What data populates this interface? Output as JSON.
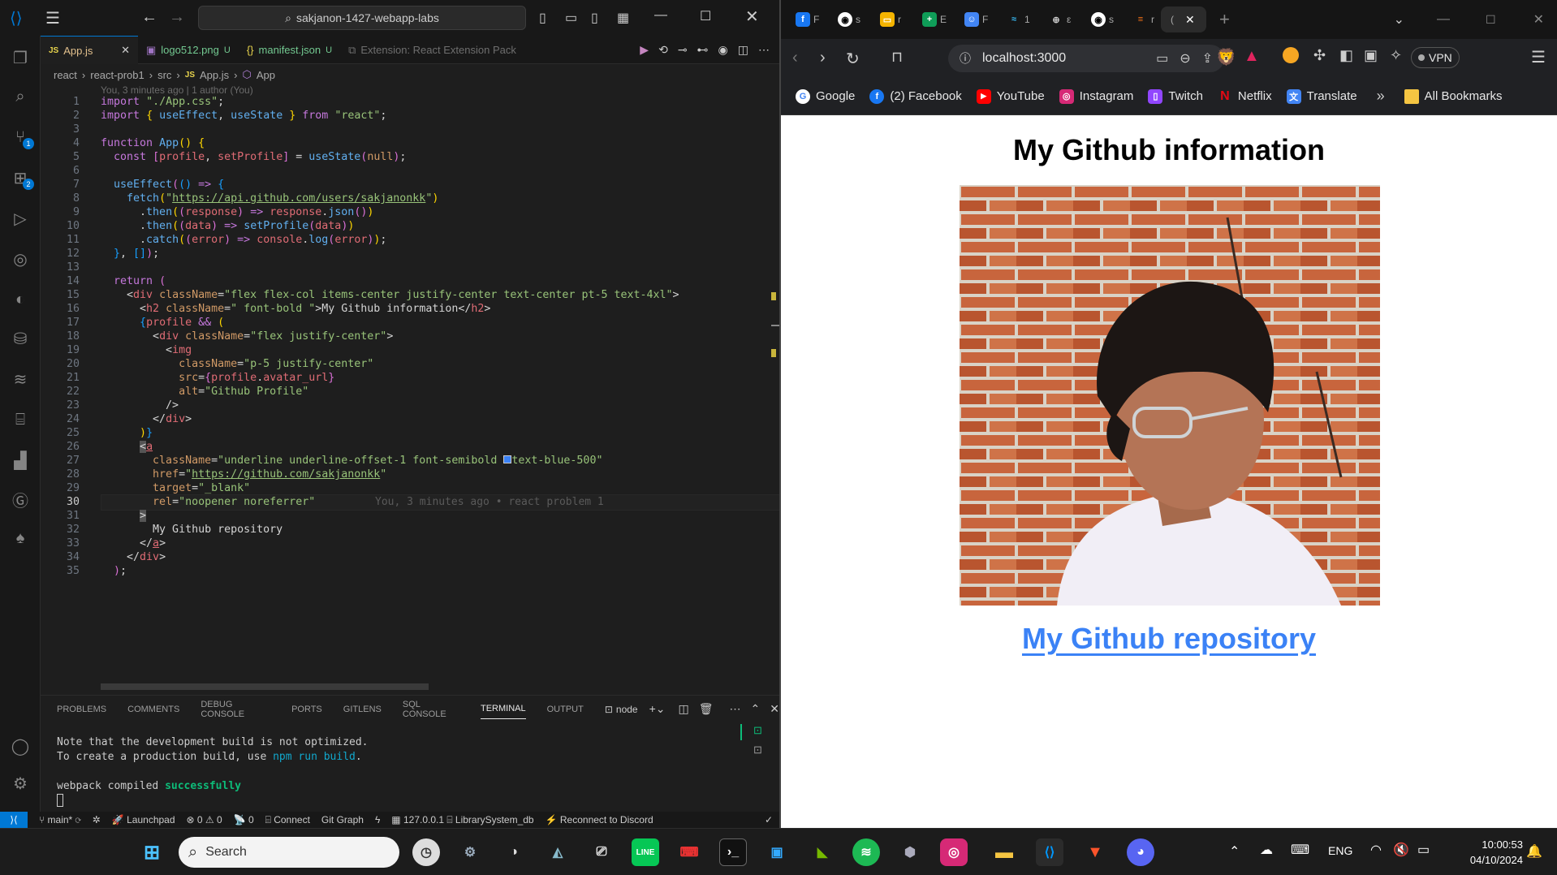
{
  "vscode": {
    "title": "sakjanon-1427-webapp-labs",
    "tabs": [
      {
        "label": "App.js",
        "marker": "JS",
        "active": true
      },
      {
        "label": "logo512.png",
        "marker": "U"
      },
      {
        "label": "manifest.json",
        "marker": "U"
      },
      {
        "label": "Extension: React Extension Pack"
      }
    ],
    "breadcrumb": [
      "react",
      "react-prob1",
      "src",
      "App.js",
      "App"
    ],
    "blame": "You, 3 minutes ago | 1 author (You)",
    "inline_blame": "You, 3 minutes ago • react problem 1",
    "current_line": "30",
    "panel_tabs": [
      "PROBLEMS",
      "COMMENTS",
      "DEBUG CONSOLE",
      "PORTS",
      "GITLENS",
      "SQL CONSOLE",
      "TERMINAL",
      "OUTPUT"
    ],
    "terminal_name": "node",
    "terminal": {
      "l1": "Note that the development build is not optimized.",
      "l2a": "To create a production build, use ",
      "l2b": "npm run build",
      "l2c": ".",
      "l3a": "webpack compiled ",
      "l3b": "successfully"
    },
    "status": {
      "branch": "main*",
      "launchpad": "Launchpad",
      "problems": "⊗ 0 ⚠ 0",
      "ports": "0",
      "connect": "Connect",
      "gitgraph": "Git Graph",
      "db": "127.0.0.1",
      "dbname": "LibrarySystem_db",
      "discord": "Reconnect to Discord"
    }
  },
  "browser": {
    "url": "localhost:3000",
    "tab_letters": [
      "F",
      "s",
      "r",
      "E",
      "F",
      "1",
      "ε",
      "s",
      "r",
      "("
    ],
    "bookmarks": [
      "Google",
      "(2) Facebook",
      "YouTube",
      "Instagram",
      "Twitch",
      "Netflix",
      "Translate",
      "All Bookmarks"
    ],
    "vpn": "VPN",
    "heading": "My Github information",
    "link": "My Github repository",
    "avatar_alt": "Github Profile"
  },
  "taskbar": {
    "search": "Search",
    "lang": "ENG",
    "time": "10:00:53",
    "date": "04/10/2024"
  },
  "colors": {
    "accent": "#0078d4",
    "link": "#3b82f6"
  }
}
